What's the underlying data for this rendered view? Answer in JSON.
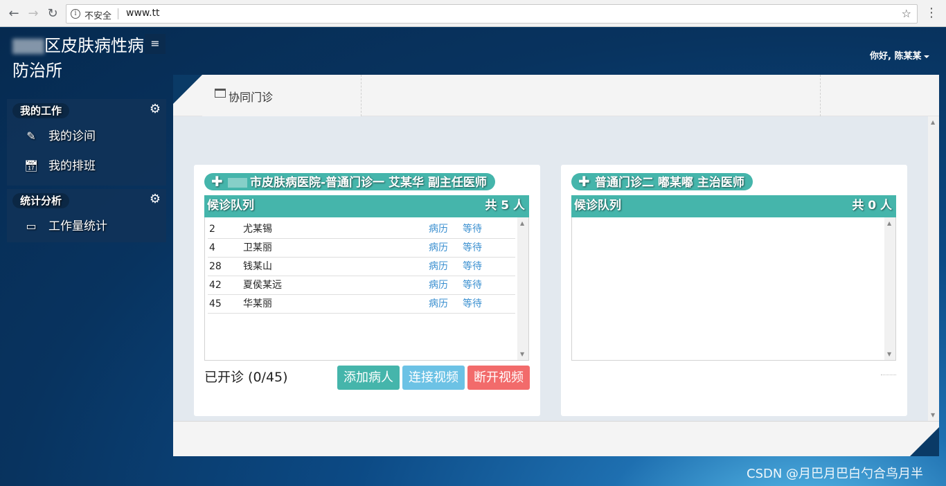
{
  "browser": {
    "insecure_label": "不安全",
    "url": "www.tt"
  },
  "app": {
    "brand_line1": "区皮肤病性病",
    "brand_line2": "防治所",
    "greeting": "你好, 陈某某"
  },
  "sidebar": {
    "groups": [
      {
        "title": "我的工作",
        "items": [
          {
            "label": "我的诊间"
          },
          {
            "label": "我的排班"
          }
        ]
      },
      {
        "title": "统计分析",
        "items": [
          {
            "label": "工作量统计"
          }
        ]
      }
    ]
  },
  "tab": {
    "label": "协同门诊"
  },
  "panels": [
    {
      "title": "市皮肤病医院-普通门诊一 艾某华 副主任医师",
      "queue_label": "候诊队列",
      "total": "共 5 人",
      "patients": [
        {
          "no": "2",
          "name": "尤某锡",
          "record": "病历",
          "status": "等待"
        },
        {
          "no": "4",
          "name": "卫某丽",
          "record": "病历",
          "status": "等待"
        },
        {
          "no": "28",
          "name": "钱某山",
          "record": "病历",
          "status": "等待"
        },
        {
          "no": "42",
          "name": "夏侯某远",
          "record": "病历",
          "status": "等待"
        },
        {
          "no": "45",
          "name": "华某丽",
          "record": "病历",
          "status": "等待"
        }
      ],
      "progress_text": "已开诊 (0/45)",
      "buttons": {
        "add": "添加病人",
        "connect": "连接视频",
        "disconnect": "断开视频"
      }
    },
    {
      "title": "普通门诊二 嘟某嘟 主治医师",
      "queue_label": "候诊队列",
      "total": "共 0 人",
      "patients": []
    }
  ],
  "watermark": "CSDN @月巴月巴白勺合鸟月半",
  "colors": {
    "accent": "#45b5ab",
    "info": "#6cc2e5",
    "danger": "#f26b6b",
    "link": "#3a8fd0"
  }
}
